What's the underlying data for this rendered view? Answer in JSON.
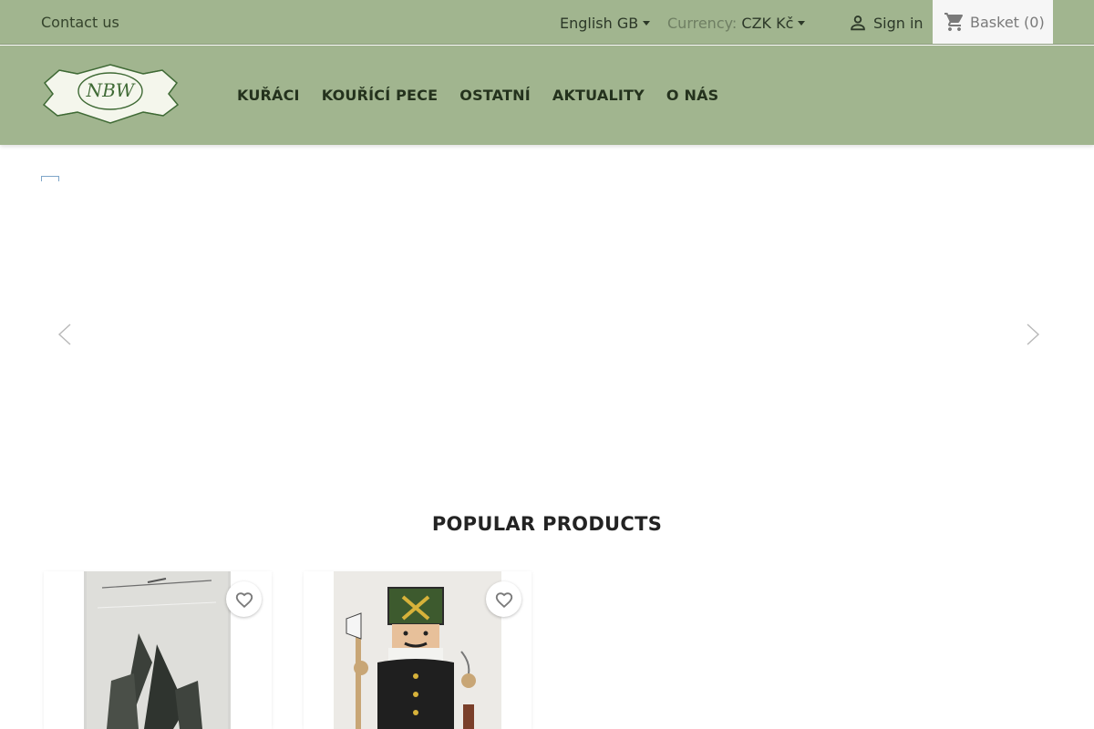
{
  "topbar": {
    "contact": "Contact us",
    "language": "English GB",
    "currency_label": "Currency:",
    "currency_value": "CZK Kč",
    "sign_in": "Sign in",
    "basket_label": "Basket",
    "basket_count": "(0)"
  },
  "header": {
    "logo_text": "NBW",
    "nav": [
      "KUŘÁCI",
      "KOUŘÍCÍ PECE",
      "OSTATNÍ",
      "AKTUALITY",
      "O NÁS"
    ]
  },
  "section": {
    "title": "POPULAR PRODUCTS"
  },
  "icons": {
    "user": "user-icon",
    "cart": "shopping-cart-icon",
    "prev": "chevron-left-icon",
    "next": "chevron-right-icon",
    "favorite": "heart-outline-icon"
  },
  "colors": {
    "header_bg": "#a1b58f",
    "basket_bg": "#f6f6f6",
    "nav_text": "#24321d"
  }
}
